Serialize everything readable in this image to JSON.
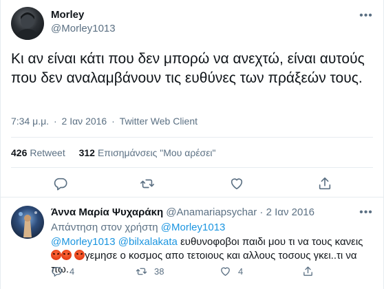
{
  "tweet": {
    "author_name": "Morley",
    "author_handle": "@Morley1013",
    "text": "Κι αν είναι κάτι που δεν μπορώ να ανεχτώ, είναι αυτούς που δεν αναλαμβάνουν τις ευθύνες των πράξεών τους.",
    "time": "7:34 μ.μ.",
    "separator": "·",
    "date": "2 Ιαν 2016",
    "client": "Twitter Web Client",
    "retweets_count": "426",
    "retweets_label": "Retweet",
    "likes_count": "312",
    "likes_label": "Επισημάνσεις \"Μου αρέσει\"",
    "more_glyph": "•••"
  },
  "icons": {
    "avatar_main": "avatar",
    "reply": "reply-icon",
    "retweet": "retweet-icon",
    "like": "heart-icon",
    "share": "share-icon",
    "more": "more-icon"
  },
  "reply": {
    "author_name": "Άννα Μαρία Ψυχαράκη",
    "author_handle": "@Anamariapsychar",
    "separator": "·",
    "date": "2 Ιαν 2016",
    "replying_prefix": "Απάντηση στον χρήστη",
    "replying_to": "@Morley1013",
    "mention_1": "@Morley1013",
    "mention_2": "@bilxalakata",
    "text_part1": "ευθυνοφοβοι παιδι μου τι να τους κανεις",
    "text_part2": "γεμησε ο κοσμος απο τετοιους και αλλους τοσους  γκει..τι να πω.",
    "reply_count": "4",
    "retweet_count": "38",
    "like_count": "4",
    "more_glyph": "•••"
  },
  "colors": {
    "accent": "#1b95e0",
    "secondary_text": "#5b7083",
    "primary_text": "#0f1419",
    "divider": "#e6ecf0"
  }
}
